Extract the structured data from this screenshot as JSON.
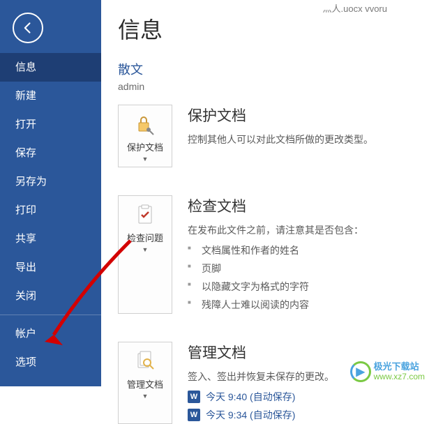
{
  "titlebar": {
    "text": "灬人.uocx  vvoru"
  },
  "sidebar": {
    "items": [
      {
        "label": "信息",
        "active": true
      },
      {
        "label": "新建"
      },
      {
        "label": "打开"
      },
      {
        "label": "保存"
      },
      {
        "label": "另存为"
      },
      {
        "label": "打印"
      },
      {
        "label": "共享"
      },
      {
        "label": "导出"
      },
      {
        "label": "关闭"
      }
    ],
    "footer": [
      {
        "label": "帐户"
      },
      {
        "label": "选项"
      }
    ]
  },
  "page": {
    "title": "信息",
    "docName": "散文",
    "docAuthor": "admin"
  },
  "sections": {
    "protect": {
      "btnLabel": "保护文档",
      "head": "保护文档",
      "desc": "控制其他人可以对此文档所做的更改类型。"
    },
    "inspect": {
      "btnLabel": "检查问题",
      "head": "检查文档",
      "desc": "在发布此文件之前，请注意其是否包含：",
      "bullets": [
        "文档属性和作者的姓名",
        "页脚",
        "以隐藏文字为格式的字符",
        "残障人士难以阅读的内容"
      ]
    },
    "manage": {
      "btnLabel": "管理文档",
      "head": "管理文档",
      "desc": "签入、签出并恢复未保存的更改。",
      "versions": [
        "今天 9:40 (自动保存)",
        "今天 9:34 (自动保存)"
      ]
    }
  },
  "watermark": {
    "name": "极光下载站",
    "url": "www.xz7.com"
  },
  "colors": {
    "brand": "#2b579a"
  }
}
